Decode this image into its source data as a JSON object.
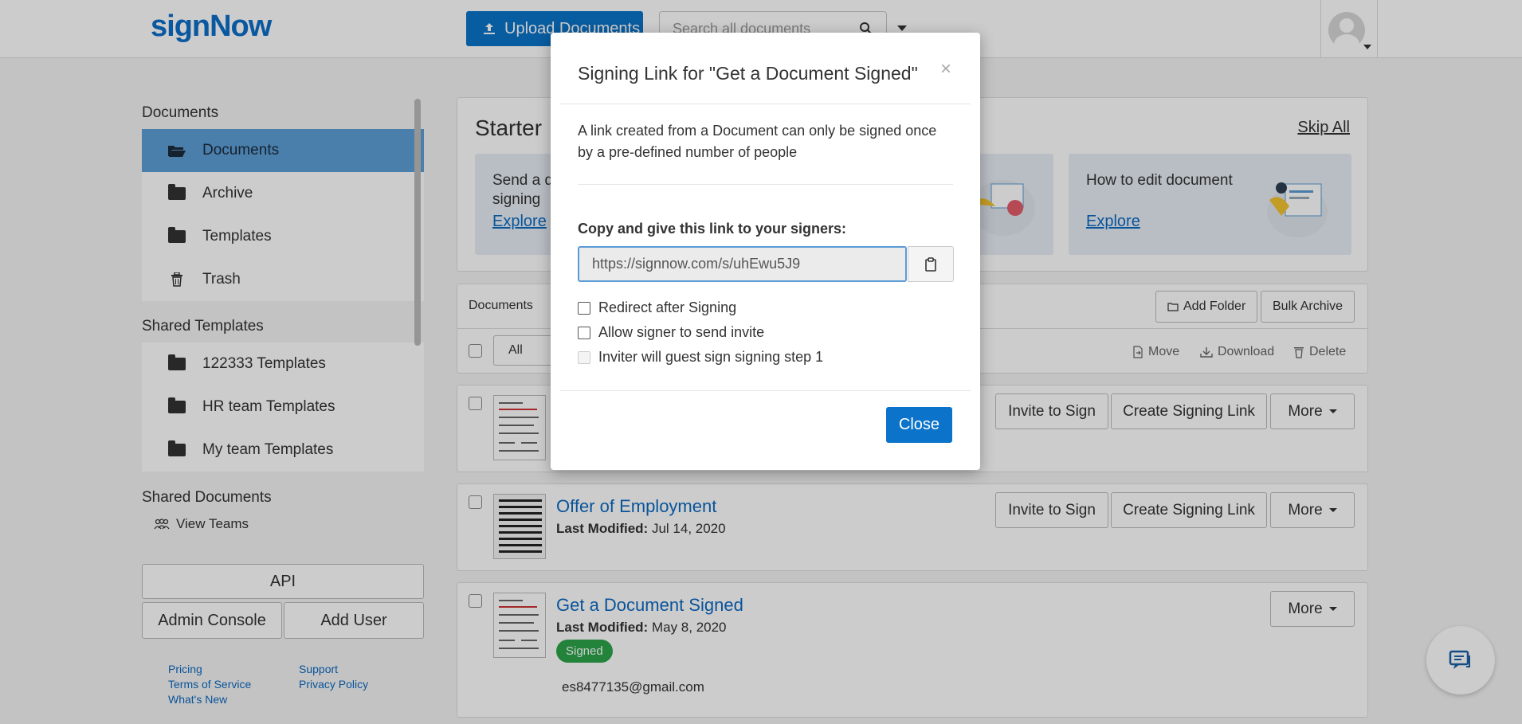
{
  "header": {
    "logo": "signNow",
    "upload_label": "Upload Documents",
    "search_placeholder": "Search all documents"
  },
  "sidebar": {
    "documents_heading": "Documents",
    "items": [
      {
        "label": "Documents"
      },
      {
        "label": "Archive"
      },
      {
        "label": "Templates"
      },
      {
        "label": "Trash"
      }
    ],
    "shared_templates_heading": "Shared Templates",
    "shared_items": [
      {
        "label": "122333 Templates"
      },
      {
        "label": "HR team Templates"
      },
      {
        "label": "My team Templates"
      }
    ],
    "shared_documents_heading": "Shared Documents",
    "view_teams": "View Teams",
    "api_label": "API",
    "admin_console_label": "Admin Console",
    "add_user_label": "Add User",
    "footer": {
      "pricing": "Pricing",
      "terms": "Terms of Service",
      "whats_new": "What's New",
      "support": "Support",
      "privacy": "Privacy Policy"
    }
  },
  "starter": {
    "title": "Starter",
    "skip_all": "Skip All",
    "cards": [
      {
        "title": "Send a document for signing",
        "link": "Explore"
      },
      {
        "title": "How to edit document",
        "link": "Explore"
      }
    ]
  },
  "toolbar": {
    "label": "Documents",
    "add_folder": "Add Folder",
    "bulk_archive": "Bulk Archive",
    "filter_value": "All",
    "move": "Move",
    "download": "Download",
    "delete": "Delete"
  },
  "documents": [
    {
      "invite": "Invite to Sign",
      "create_link": "Create Signing Link",
      "more": "More"
    },
    {
      "title": "Offer of Employment",
      "modified_label": "Last Modified:",
      "modified": "Jul 14, 2020",
      "invite": "Invite to Sign",
      "create_link": "Create Signing Link",
      "more": "More"
    },
    {
      "title": "Get a Document Signed",
      "modified_label": "Last Modified:",
      "modified": "May 8, 2020",
      "status": "Signed",
      "email": "es8477135@gmail.com",
      "more": "More"
    }
  ],
  "modal": {
    "title": "Signing Link for \"Get a Document Signed\"",
    "close_x": "×",
    "description": "A link created from a Document can only be signed once by a pre-defined number of people",
    "copy_label": "Copy and give this link to your signers:",
    "link_value": "https://signnow.com/s/uhEwu5J9",
    "options": [
      {
        "label": "Redirect after Signing",
        "checked": false,
        "disabled": false
      },
      {
        "label": "Allow signer to send invite",
        "checked": false,
        "disabled": false
      },
      {
        "label": "Inviter will guest sign signing step 1",
        "checked": false,
        "disabled": true
      }
    ],
    "close_label": "Close"
  },
  "colors": {
    "brand": "#0b73c9",
    "active_item": "#5d9fd8",
    "signed_badge": "#2ca44a",
    "link": "#0b6ac2"
  }
}
